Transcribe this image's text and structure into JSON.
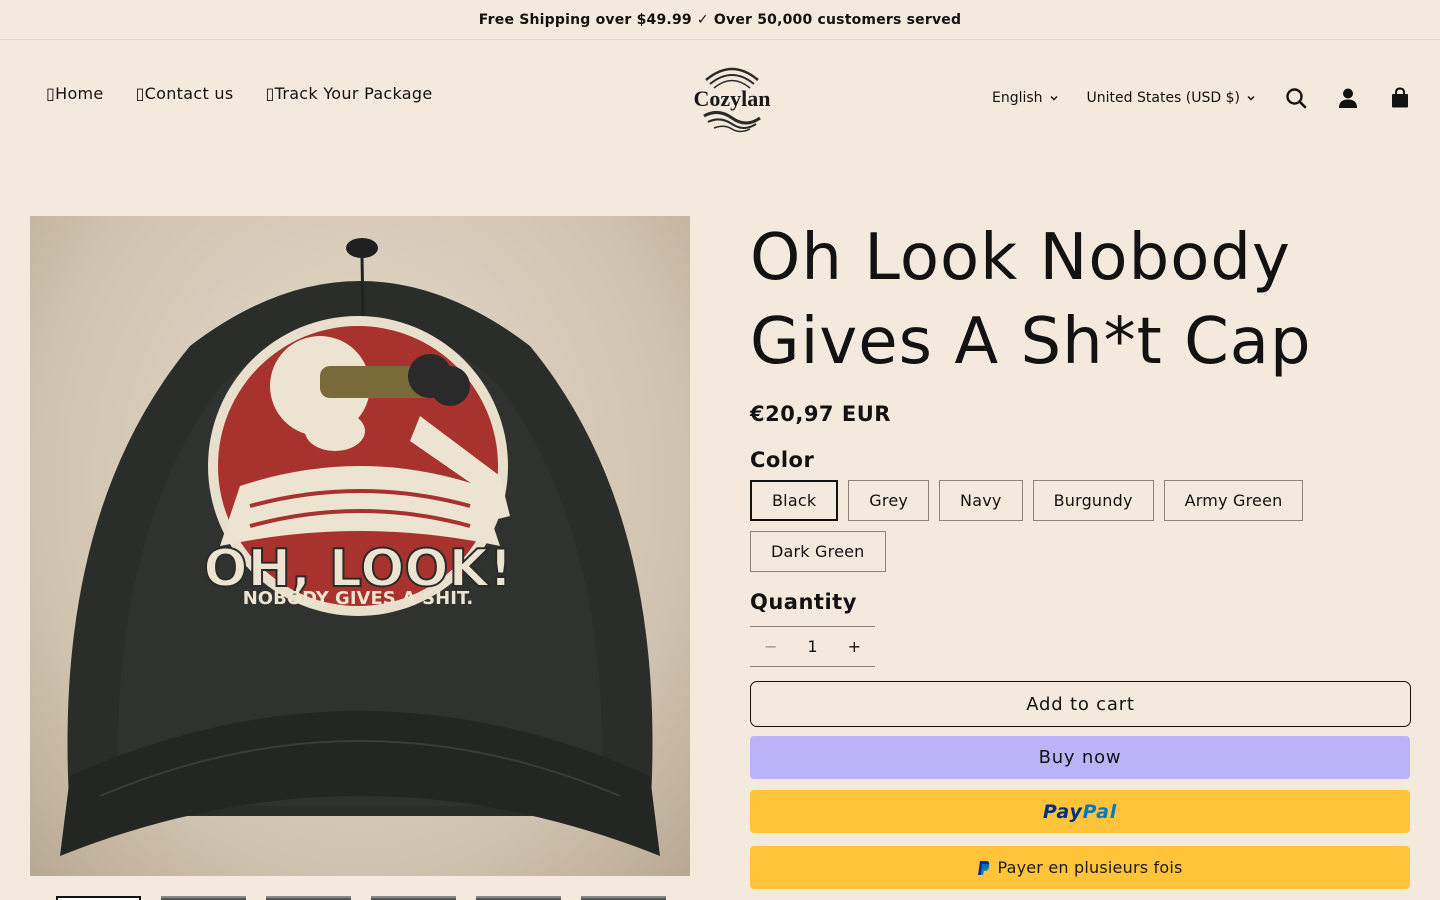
{
  "announcement": "Free Shipping over $49.99 ✓ Over 50,000 customers served",
  "nav": [
    {
      "label": "Home",
      "icon": "home-icon"
    },
    {
      "label": "Contact us",
      "icon": "contact-icon"
    },
    {
      "label": "Track Your Package",
      "icon": "package-icon"
    }
  ],
  "brand": {
    "name": "Cozylan"
  },
  "header": {
    "language": "English",
    "country": "United States (USD $)"
  },
  "product": {
    "title": "Oh Look Nobody Gives A Sh*t Cap",
    "price": "€20,97 EUR",
    "image_caption_line1": "OH, LOOK!",
    "image_caption_line2": "NOBODY GIVES A SHIT.",
    "color_label": "Color",
    "colors": [
      "Black",
      "Grey",
      "Navy",
      "Burgundy",
      "Army Green",
      "Dark Green"
    ],
    "selected_color": "Black",
    "quantity_label": "Quantity",
    "quantity": "1",
    "minus": "−",
    "plus": "+",
    "add_to_cart": "Add to cart",
    "buy_now": "Buy now",
    "paypal_a": "Pay",
    "paypal_b": "Pal",
    "pay_later": "Payer en plusieurs fois"
  },
  "colors": {
    "background": "#f3e9dc",
    "buy_now": "#bbb4f8",
    "paypal": "#ffc43a",
    "text": "#121212"
  }
}
